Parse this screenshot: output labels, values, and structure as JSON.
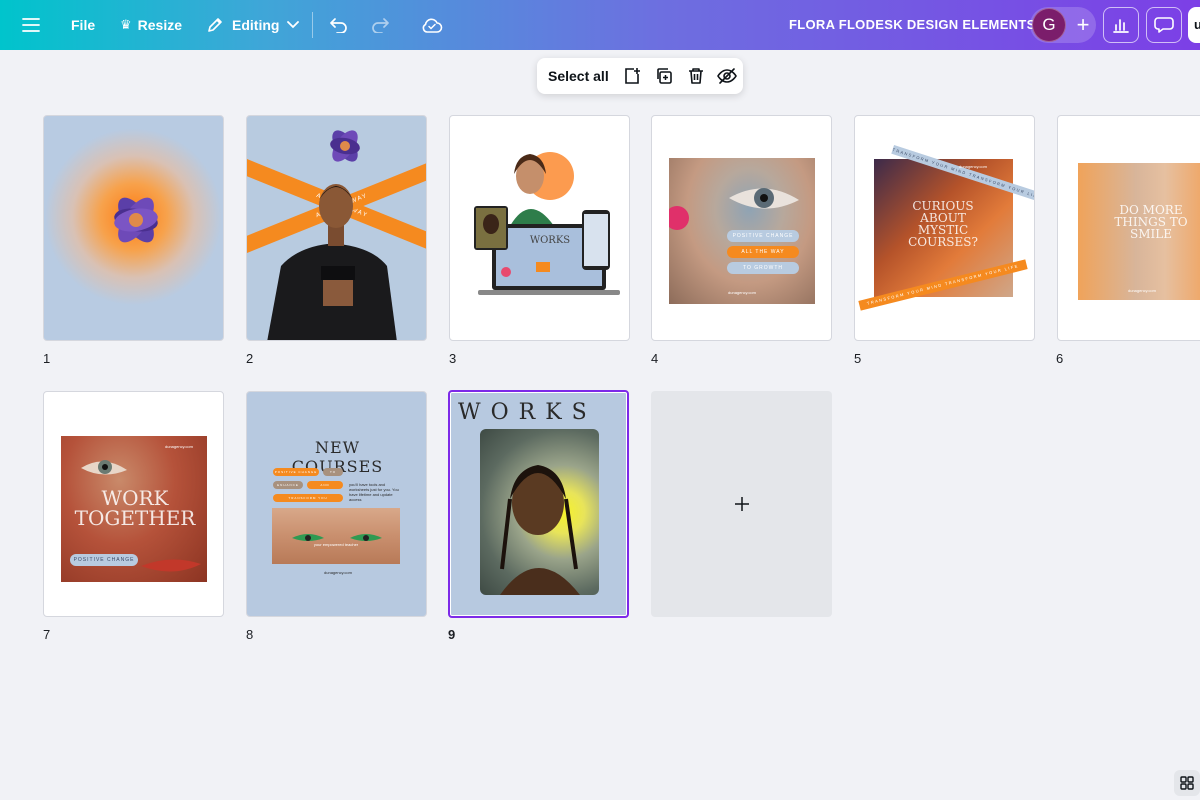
{
  "topbar": {
    "file_label": "File",
    "resize_label": "Resize",
    "editing_label": "Editing",
    "document_title": "FLORA FLODESK DESIGN ELEMENTS",
    "avatar_initial": "G",
    "share_initial": "u",
    "gradient_start": "#00c4cc",
    "gradient_end": "#7c3fe6"
  },
  "selection_toolbar": {
    "select_all_label": "Select all",
    "icons": [
      "add-page-icon",
      "duplicate-icon",
      "trash-icon",
      "hide-icon"
    ]
  },
  "pages": [
    {
      "number": "1"
    },
    {
      "number": "2",
      "band_text": "ALL THE WAY"
    },
    {
      "number": "3",
      "screen_text": "WORKS"
    },
    {
      "number": "4",
      "pill1": "POSITIVE CHANGE",
      "pill2": "ALL THE WAY",
      "pill3": "TO GROWTH",
      "footer": "dunagency.com"
    },
    {
      "number": "5",
      "headline": "CURIOUS ABOUT MYSTIC COURSES?",
      "strip_text": "TRANSFORM YOUR MIND TRANSFORM YOUR LIFE",
      "footer": "dunagency.com"
    },
    {
      "number": "6",
      "headline": "DO MORE THINGS TO SMILE",
      "footer": "dunagency.com"
    },
    {
      "number": "7",
      "headline": "WORK TOGETHER",
      "pill": "POSITIVE CHANGE",
      "footer": "dunagency.com"
    },
    {
      "number": "8",
      "headline": "NEW COURSES",
      "pills": [
        "POSITIVE CHANGE",
        "TO",
        "ENHANCE",
        "AND",
        "TRANSFORM YOU"
      ],
      "body": "you'll have tools and worksheets just for you. You have lifetime and update access",
      "strip": "your empowered teacher",
      "footer": "dunagency.com"
    },
    {
      "number": "9",
      "headline": "WORKS",
      "selected": true
    }
  ],
  "colors": {
    "accent_purple": "#7d2ae8",
    "orange": "#f58a1f",
    "canvas_blue": "#b7c9e0"
  }
}
